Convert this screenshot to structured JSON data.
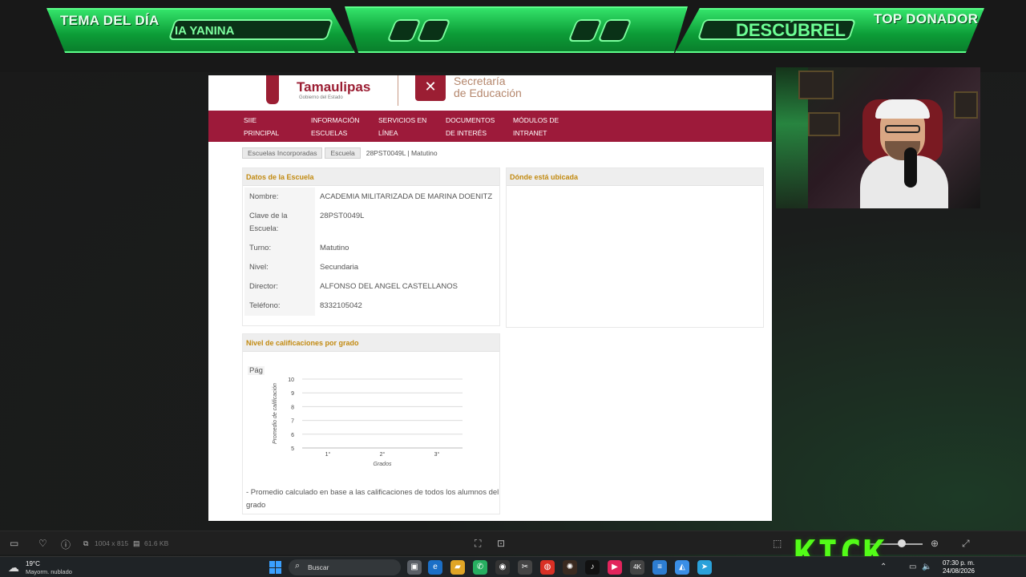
{
  "overlay": {
    "left_label": "TEMA DEL DÍA",
    "left_slot_text": "IA YANINA",
    "right_label": "TOP DONADOR",
    "right_slot_text": "DESCÚBREL"
  },
  "site": {
    "logo_title": "Tamaulipas",
    "logo_sub": "Gobierno del Estado",
    "sec_line1": "Secretaría",
    "sec_line2": "de Educación",
    "nav": [
      {
        "line1": "SIIE",
        "line2": "PRINCIPAL"
      },
      {
        "line1": "INFORMACIÓN",
        "line2": "ESCUELAS"
      },
      {
        "line1": "SERVICIOS EN",
        "line2": "LÍNEA"
      },
      {
        "line1": "DOCUMENTOS",
        "line2": "DE INTERÉS"
      },
      {
        "line1": "MÓDULOS DE",
        "line2": "INTRANET"
      }
    ],
    "breadcrumb": [
      "Escuelas Incorporadas",
      "Escuela"
    ],
    "breadcrumb_current": "28PST0049L | Matutino"
  },
  "school": {
    "title": "Datos de la Escuela",
    "rows": [
      {
        "key": "Nombre:",
        "value": "ACADEMIA MILITARIZADA DE MARINA DOENITZ"
      },
      {
        "key": "Clave de la Escuela:",
        "value": "28PST0049L"
      },
      {
        "key": "Turno:",
        "value": "Matutino"
      },
      {
        "key": "Nivel:",
        "value": "Secundaria"
      },
      {
        "key": "Director:",
        "value": "ALFONSO DEL ANGEL CASTELLANOS"
      },
      {
        "key": "Teléfono:",
        "value": "8332105042"
      }
    ]
  },
  "location": {
    "title": "Dónde está ubicada"
  },
  "grades": {
    "title": "Nivel de calificaciones por grado",
    "cut_text": "Pág",
    "note": "- Promedio calculado en base a las calificaciones de todos los alumnos del grado"
  },
  "chart_data": {
    "type": "bar",
    "categories": [
      "1°",
      "2°",
      "3°"
    ],
    "values": [],
    "xlabel": "Grados",
    "ylabel": "Promedio de calificación",
    "ylim": [
      5,
      10
    ],
    "yticks": [
      5,
      6,
      7,
      8,
      9,
      10
    ],
    "grid": true
  },
  "viewer": {
    "dims": "1004 x 815",
    "size": "61.6 KB"
  },
  "kick": {
    "logo": "KICK"
  },
  "taskbar": {
    "temp": "19°C",
    "weather": "Mayorm. nublado",
    "search": "Buscar",
    "time": "07:30 p. m.",
    "date": "24/08/2026"
  }
}
